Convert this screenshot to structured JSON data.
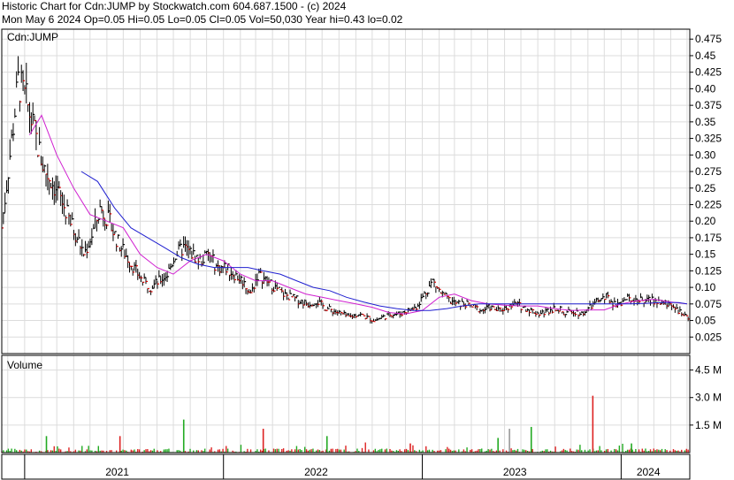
{
  "header": {
    "line1": "Historic Chart for Cdn:JUMP by Stockwatch.com 604.687.1500 - (c) 2024",
    "line2": "Mon May  6 2024  Op=0.05  Hi=0.05  Lo=0.05  Cl=0.05  Vol=50,030  Year hi=0.43  lo=0.02"
  },
  "chart_data": {
    "type": "line",
    "symbol_label": "Cdn:JUMP",
    "volume_label": "Volume",
    "price_axis": {
      "ylim": [
        0.0,
        0.49
      ],
      "ticks": [
        {
          "v": 0.475,
          "t": "0.475"
        },
        {
          "v": 0.45,
          "t": "0.45"
        },
        {
          "v": 0.425,
          "t": "0.425"
        },
        {
          "v": 0.4,
          "t": "0.40"
        },
        {
          "v": 0.375,
          "t": "0.375"
        },
        {
          "v": 0.35,
          "t": "0.35"
        },
        {
          "v": 0.325,
          "t": "0.325"
        },
        {
          "v": 0.3,
          "t": "0.30"
        },
        {
          "v": 0.275,
          "t": "0.275"
        },
        {
          "v": 0.25,
          "t": "0.25"
        },
        {
          "v": 0.225,
          "t": "0.225"
        },
        {
          "v": 0.2,
          "t": "0.20"
        },
        {
          "v": 0.175,
          "t": "0.175"
        },
        {
          "v": 0.15,
          "t": "0.15"
        },
        {
          "v": 0.125,
          "t": "0.125"
        },
        {
          "v": 0.1,
          "t": "0.10"
        },
        {
          "v": 0.075,
          "t": "0.075"
        },
        {
          "v": 0.05,
          "t": "0.05"
        },
        {
          "v": 0.025,
          "t": "0.025"
        }
      ]
    },
    "volume_axis": {
      "ylim": [
        0,
        5.3
      ],
      "ticks": [
        {
          "v": 4.5,
          "t": "4.5 M"
        },
        {
          "v": 3.0,
          "t": "3.0 M"
        },
        {
          "v": 1.5,
          "t": "1.5 M"
        }
      ]
    },
    "x_range": [
      "2020-11-20",
      "2024-05-06"
    ],
    "year_labels": [
      {
        "label": "2021",
        "date": "2021-06-20"
      },
      {
        "label": "2022",
        "date": "2022-06-20"
      },
      {
        "label": "2023",
        "date": "2023-06-20"
      },
      {
        "label": "2024",
        "date": "2024-02-20"
      }
    ],
    "year_boundaries": [
      "2021-01-01",
      "2022-01-01",
      "2023-01-01",
      "2024-01-01"
    ],
    "month_gridlines": true,
    "price_series": {
      "name": "",
      "x": [
        "2020-11-20",
        "2020-12-05",
        "2020-12-20",
        "2021-01-05",
        "2021-01-20",
        "2021-02-05",
        "2021-02-20",
        "2021-03-05",
        "2021-03-20",
        "2021-04-05",
        "2021-04-20",
        "2021-05-05",
        "2021-05-20",
        "2021-06-05",
        "2021-06-20",
        "2021-07-05",
        "2021-07-20",
        "2021-08-05",
        "2021-08-20",
        "2021-09-05",
        "2021-09-20",
        "2021-10-05",
        "2021-10-20",
        "2021-11-05",
        "2021-11-20",
        "2021-12-05",
        "2021-12-20",
        "2022-01-05",
        "2022-01-20",
        "2022-02-05",
        "2022-02-20",
        "2022-03-05",
        "2022-03-20",
        "2022-04-05",
        "2022-04-20",
        "2022-05-05",
        "2022-05-20",
        "2022-06-05",
        "2022-06-20",
        "2022-07-05",
        "2022-07-20",
        "2022-08-05",
        "2022-08-20",
        "2022-09-05",
        "2022-09-20",
        "2022-10-05",
        "2022-10-20",
        "2022-11-05",
        "2022-11-20",
        "2022-12-05",
        "2022-12-20",
        "2023-01-05",
        "2023-01-20",
        "2023-02-05",
        "2023-02-20",
        "2023-03-05",
        "2023-03-20",
        "2023-04-05",
        "2023-04-20",
        "2023-05-05",
        "2023-05-20",
        "2023-06-05",
        "2023-06-20",
        "2023-07-05",
        "2023-07-20",
        "2023-08-05",
        "2023-08-20",
        "2023-09-05",
        "2023-09-20",
        "2023-10-05",
        "2023-10-20",
        "2023-11-05",
        "2023-11-20",
        "2023-12-05",
        "2023-12-20",
        "2024-01-05",
        "2024-01-20",
        "2024-02-05",
        "2024-02-20",
        "2024-03-05",
        "2024-03-20",
        "2024-04-05",
        "2024-04-20",
        "2024-05-06"
      ],
      "close": [
        0.19,
        0.3,
        0.41,
        0.38,
        0.33,
        0.28,
        0.26,
        0.24,
        0.21,
        0.18,
        0.15,
        0.18,
        0.22,
        0.2,
        0.17,
        0.15,
        0.13,
        0.11,
        0.1,
        0.11,
        0.12,
        0.15,
        0.16,
        0.15,
        0.14,
        0.15,
        0.13,
        0.13,
        0.12,
        0.11,
        0.09,
        0.12,
        0.11,
        0.1,
        0.09,
        0.085,
        0.08,
        0.075,
        0.08,
        0.07,
        0.065,
        0.06,
        0.055,
        0.06,
        0.055,
        0.05,
        0.055,
        0.06,
        0.06,
        0.065,
        0.07,
        0.09,
        0.11,
        0.09,
        0.08,
        0.075,
        0.075,
        0.07,
        0.065,
        0.07,
        0.065,
        0.07,
        0.075,
        0.07,
        0.065,
        0.06,
        0.065,
        0.07,
        0.06,
        0.065,
        0.06,
        0.07,
        0.08,
        0.085,
        0.075,
        0.08,
        0.085,
        0.08,
        0.08,
        0.08,
        0.075,
        0.075,
        0.06,
        0.05
      ]
    },
    "moving_averages": [
      {
        "name": "",
        "color": "#d020d0",
        "x": [
          "2021-01-10",
          "2021-02-01",
          "2021-03-01",
          "2021-04-01",
          "2021-05-01",
          "2021-06-01",
          "2021-07-01",
          "2021-08-01",
          "2021-09-01",
          "2021-10-01",
          "2021-11-01",
          "2021-12-01",
          "2022-01-01",
          "2022-02-01",
          "2022-03-01",
          "2022-04-01",
          "2022-05-01",
          "2022-06-01",
          "2022-07-01",
          "2022-08-01",
          "2022-09-01",
          "2022-10-01",
          "2022-11-01",
          "2022-12-01",
          "2023-01-01",
          "2023-02-01",
          "2023-03-01",
          "2023-04-01",
          "2023-05-01",
          "2023-06-01",
          "2023-07-01",
          "2023-08-01",
          "2023-09-01",
          "2023-10-01",
          "2023-11-01",
          "2023-12-01",
          "2024-01-01",
          "2024-02-01",
          "2024-03-01",
          "2024-04-01",
          "2024-05-01"
        ],
        "values": [
          0.33,
          0.36,
          0.3,
          0.25,
          0.21,
          0.2,
          0.19,
          0.15,
          0.13,
          0.12,
          0.14,
          0.15,
          0.14,
          0.12,
          0.11,
          0.11,
          0.1,
          0.09,
          0.085,
          0.08,
          0.075,
          0.07,
          0.062,
          0.06,
          0.065,
          0.085,
          0.09,
          0.08,
          0.075,
          0.073,
          0.072,
          0.072,
          0.068,
          0.065,
          0.066,
          0.066,
          0.075,
          0.08,
          0.082,
          0.078,
          0.075
        ]
      },
      {
        "name": "",
        "color": "#2020d0",
        "x": [
          "2021-04-15",
          "2021-05-15",
          "2021-06-15",
          "2021-07-15",
          "2021-08-15",
          "2021-09-15",
          "2021-10-15",
          "2021-11-15",
          "2021-12-15",
          "2022-01-15",
          "2022-02-15",
          "2022-03-15",
          "2022-04-15",
          "2022-05-15",
          "2022-06-15",
          "2022-07-15",
          "2022-08-15",
          "2022-09-15",
          "2022-10-15",
          "2022-11-15",
          "2022-12-15",
          "2023-01-15",
          "2023-02-15",
          "2023-03-15",
          "2023-04-15",
          "2023-05-15",
          "2023-06-15",
          "2023-07-15",
          "2023-08-15",
          "2023-09-15",
          "2023-10-15",
          "2023-11-15",
          "2023-12-15",
          "2024-01-15",
          "2024-02-15",
          "2024-03-15",
          "2024-04-15",
          "2024-05-01"
        ],
        "values": [
          0.275,
          0.26,
          0.22,
          0.19,
          0.175,
          0.16,
          0.145,
          0.135,
          0.13,
          0.13,
          0.13,
          0.125,
          0.12,
          0.11,
          0.1,
          0.095,
          0.085,
          0.078,
          0.072,
          0.068,
          0.065,
          0.065,
          0.068,
          0.072,
          0.075,
          0.075,
          0.075,
          0.075,
          0.075,
          0.075,
          0.075,
          0.075,
          0.075,
          0.075,
          0.076,
          0.077,
          0.077,
          0.075
        ]
      }
    ],
    "volume_spikes": [
      {
        "date": "2021-02-10",
        "v": 0.9
      },
      {
        "date": "2021-06-25",
        "v": 0.9
      },
      {
        "date": "2021-10-20",
        "v": 1.8
      },
      {
        "date": "2022-03-15",
        "v": 1.3
      },
      {
        "date": "2022-07-10",
        "v": 0.9
      },
      {
        "date": "2022-12-10",
        "v": 0.5
      },
      {
        "date": "2023-05-20",
        "v": 0.8
      },
      {
        "date": "2023-06-10",
        "v": 1.3
      },
      {
        "date": "2023-07-20",
        "v": 1.4
      },
      {
        "date": "2023-11-10",
        "v": 3.1
      },
      {
        "date": "2024-01-20",
        "v": 0.5
      }
    ],
    "colors": {
      "up_volume": "#22aa22",
      "down_volume": "#dd2222",
      "flat_volume": "#999999",
      "price_bar": "#000000",
      "price_down_tick": "#dd0000",
      "grid": "#dcdcdc",
      "frame": "#000000"
    }
  }
}
